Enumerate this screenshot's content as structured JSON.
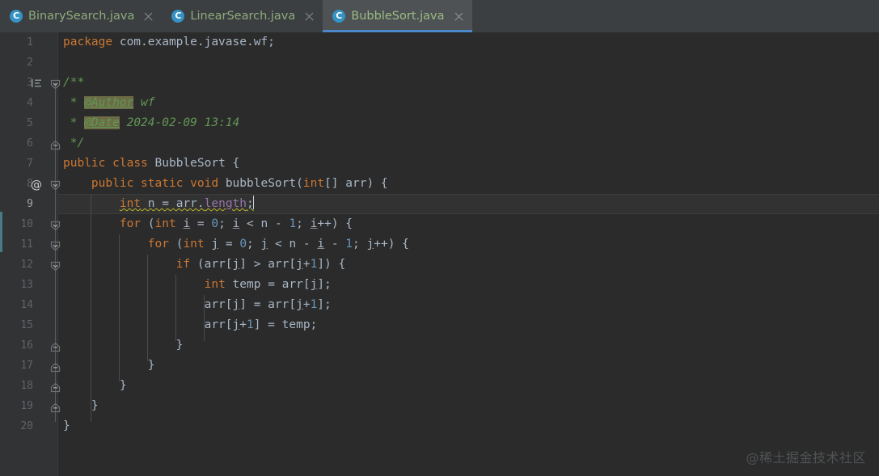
{
  "window": {
    "theme": "darcula",
    "accent_color": "#4a88c7",
    "editor_background": "#2b2b2b",
    "gutter_background": "#313335",
    "tabbar_background": "#3c3f41"
  },
  "tabs": [
    {
      "label": "BinarySearch.java",
      "icon": "java-class-icon",
      "icon_letter": "C",
      "active": false,
      "close_label": "close-tab"
    },
    {
      "label": "LinearSearch.java",
      "icon": "java-class-icon",
      "icon_letter": "C",
      "active": false,
      "close_label": "close-tab"
    },
    {
      "label": "BubbleSort.java",
      "icon": "java-class-icon",
      "icon_letter": "C",
      "active": true,
      "close_label": "close-tab"
    }
  ],
  "gutter": {
    "line_numbers": [
      "1",
      "2",
      "3",
      "4",
      "5",
      "6",
      "7",
      "8",
      "9",
      "10",
      "11",
      "12",
      "13",
      "14",
      "15",
      "16",
      "17",
      "18",
      "19",
      "20"
    ],
    "current_line": 9,
    "annotations": [
      {
        "line": 3,
        "icon": "javadoc-list-icon"
      },
      {
        "line": 8,
        "icon": "override-annotation-icon",
        "glyph": "@"
      }
    ],
    "fold_markers": [
      {
        "line": 3,
        "state": "expanded"
      },
      {
        "line": 6,
        "state": "fold-end"
      },
      {
        "line": 8,
        "state": "expanded"
      },
      {
        "line": 10,
        "state": "expanded"
      },
      {
        "line": 11,
        "state": "expanded"
      },
      {
        "line": 12,
        "state": "expanded"
      },
      {
        "line": 16,
        "state": "fold-end"
      },
      {
        "line": 17,
        "state": "fold-end"
      },
      {
        "line": 18,
        "state": "fold-end"
      },
      {
        "line": 19,
        "state": "fold-end"
      }
    ]
  },
  "code": {
    "language": "java",
    "caret_line": 9,
    "caret_column": 31,
    "lines": [
      {
        "n": 1,
        "text": "package com.example.javase.wf;"
      },
      {
        "n": 2,
        "text": ""
      },
      {
        "n": 3,
        "text": "/**"
      },
      {
        "n": 4,
        "text": " * @Author wf"
      },
      {
        "n": 5,
        "text": " * @Date 2024-02-09 13:14"
      },
      {
        "n": 6,
        "text": " */"
      },
      {
        "n": 7,
        "text": "public class BubbleSort {"
      },
      {
        "n": 8,
        "text": "    public static void bubbleSort(int[] arr) {"
      },
      {
        "n": 9,
        "text": "        int n = arr.length;"
      },
      {
        "n": 10,
        "text": "        for (int i = 0; i < n - 1; i++) {"
      },
      {
        "n": 11,
        "text": "            for (int j = 0; j < n - i - 1; j++) {"
      },
      {
        "n": 12,
        "text": "                if (arr[j] > arr[j+1]) {"
      },
      {
        "n": 13,
        "text": "                    int temp = arr[j];"
      },
      {
        "n": 14,
        "text": "                    arr[j] = arr[j+1];"
      },
      {
        "n": 15,
        "text": "                    arr[j+1] = temp;"
      },
      {
        "n": 16,
        "text": "                }"
      },
      {
        "n": 17,
        "text": "            }"
      },
      {
        "n": 18,
        "text": "        }"
      },
      {
        "n": 19,
        "text": "    }"
      },
      {
        "n": 20,
        "text": "}"
      }
    ],
    "javadoc": {
      "author_tag": "@Author",
      "author_value": "wf",
      "date_tag": "@Date",
      "date_value": "2024-02-09 13:14"
    },
    "warnings": [
      {
        "line": 9,
        "text": "int n = arr.length;",
        "severity": "warning",
        "color": "#bbb529"
      }
    ],
    "token_colors": {
      "keyword": "#cc7832",
      "number": "#6897bb",
      "plain": "#a9b7c6",
      "field": "#9876aa",
      "comment": "#629755",
      "doc_tag_background": "#6b6b45"
    }
  },
  "watermark": {
    "text": "@稀土掘金技术社区"
  }
}
